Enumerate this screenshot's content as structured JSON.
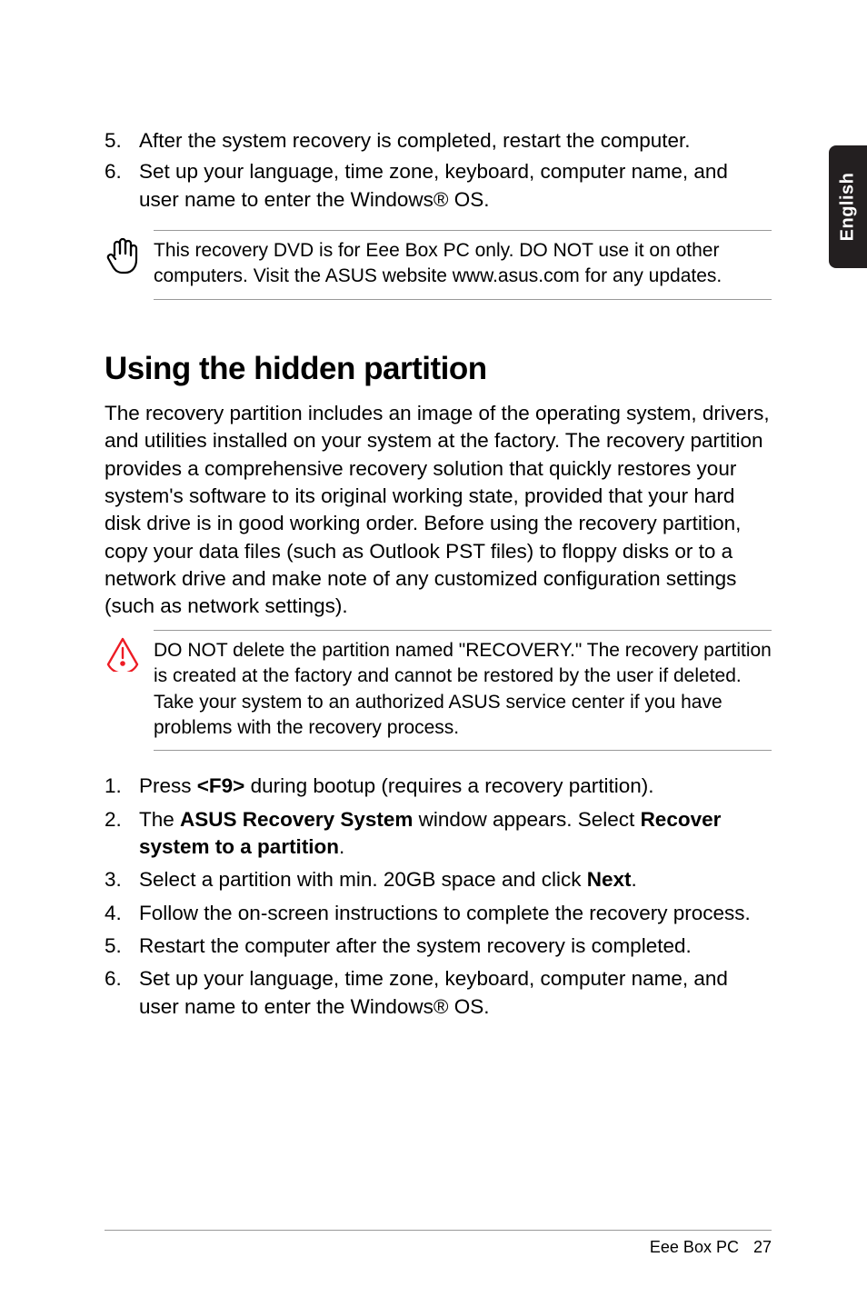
{
  "side_tab": "English",
  "top_list": {
    "item5": {
      "num": "5.",
      "text": "After the system recovery is completed, restart the computer."
    },
    "item6": {
      "num": "6.",
      "text": "Set up your language, time zone, keyboard, computer name, and user name to enter the Windows® OS."
    }
  },
  "note1": "This recovery DVD is for Eee Box PC only. DO NOT use it on other computers. Visit the ASUS website www.asus.com for any updates.",
  "section_heading": "Using the hidden partition",
  "intro_para": "The recovery partition includes an image of the operating system, drivers, and utilities installed on your system at the factory. The recovery partition provides a comprehensive recovery solution that quickly restores your system's software to its original working state, provided that your hard disk drive is in good working order. Before using the recovery partition, copy your data files (such as Outlook PST files) to floppy disks or to a network drive and make note of any customized configuration settings (such as network settings).",
  "warn1": "DO NOT delete the partition named \"RECOVERY.\" The recovery partition is created at the factory and cannot be restored by the user if deleted. Take your system to an authorized ASUS service center if you have problems with the recovery process.",
  "steps": {
    "s1": {
      "num": "1.",
      "pre": "Press ",
      "key": "<F9>",
      "post": " during bootup (requires a recovery partition)."
    },
    "s2": {
      "num": "2.",
      "pre": "The ",
      "b1": "ASUS Recovery System",
      "mid": " window appears. Select ",
      "b2": "Recover system to a partition",
      "post": "."
    },
    "s3": {
      "num": "3.",
      "pre": "Select a partition with min. 20GB space and click ",
      "b1": "Next",
      "post": "."
    },
    "s4": {
      "num": "4.",
      "text": "Follow the on-screen instructions to complete the recovery process."
    },
    "s5": {
      "num": "5.",
      "text": "Restart the computer after the system recovery is completed."
    },
    "s6": {
      "num": "6.",
      "text": "Set up your language, time zone, keyboard, computer name, and user name to enter the Windows® OS."
    }
  },
  "footer": {
    "product": "Eee Box PC",
    "page": "27"
  }
}
